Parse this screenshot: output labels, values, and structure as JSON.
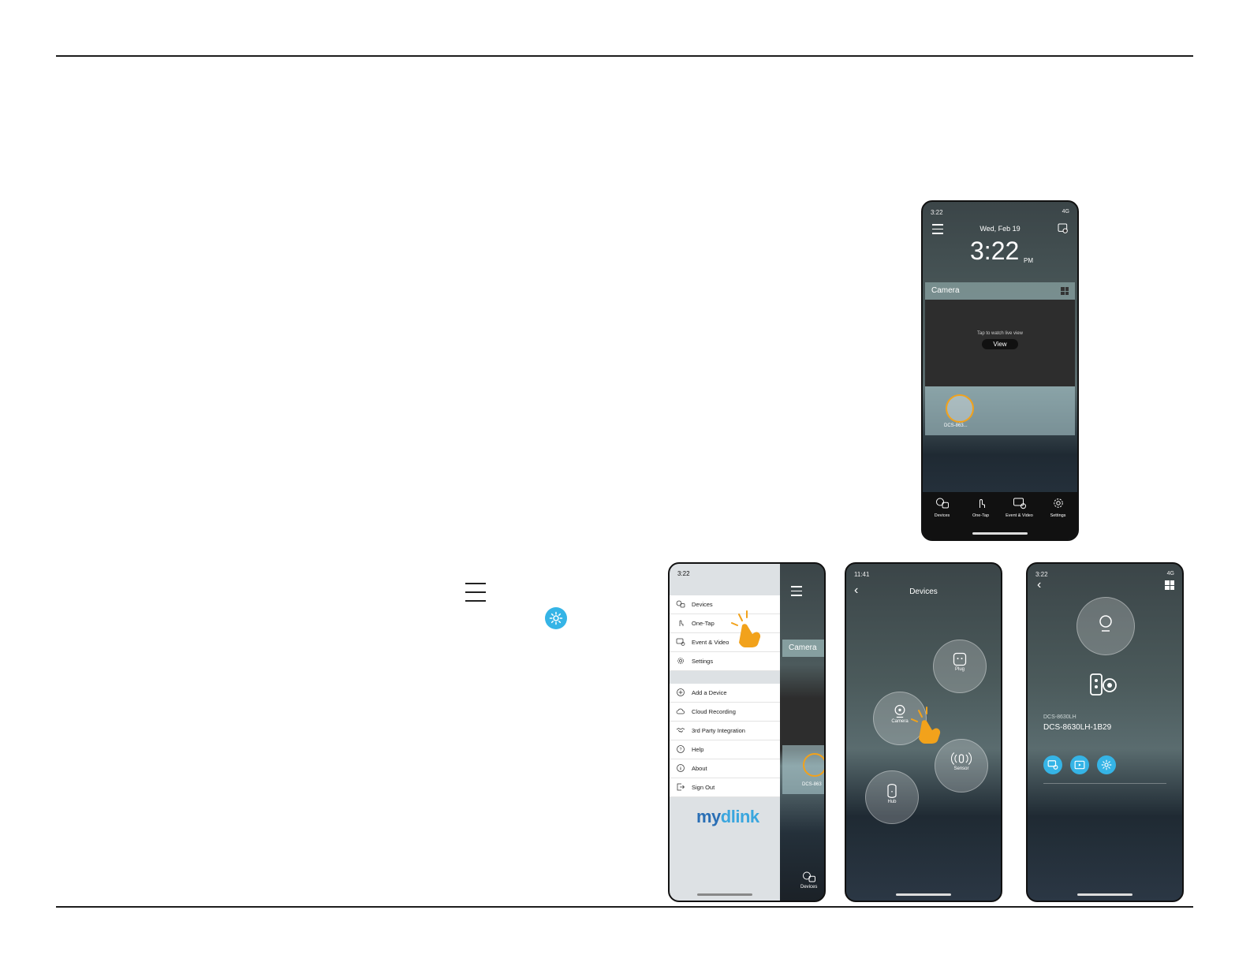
{
  "footer": {
    "text": ""
  },
  "phone_home": {
    "status_time": "3:22",
    "status_network": "4G",
    "date": "Wed, Feb 19",
    "time": "3:22",
    "ampm": "PM",
    "camera_header": "Camera",
    "tap_text": "Tap to watch live view",
    "view_button": "View",
    "device_label": "DCS-863...",
    "tabs": [
      {
        "label": "Devices",
        "icon": "devices-icon"
      },
      {
        "label": "One-Tap",
        "icon": "one-tap-icon"
      },
      {
        "label": "Event & Video",
        "icon": "event-video-icon"
      },
      {
        "label": "Settings",
        "icon": "settings-icon"
      }
    ]
  },
  "phone_menu": {
    "status_time": "3:22",
    "status_network": "4G",
    "main_items": [
      {
        "label": "Devices",
        "icon": "devices-icon"
      },
      {
        "label": "One-Tap",
        "icon": "one-tap-icon"
      },
      {
        "label": "Event & Video",
        "icon": "event-video-icon"
      },
      {
        "label": "Settings",
        "icon": "settings-icon"
      }
    ],
    "secondary_items": [
      {
        "label": "Add a Device",
        "icon": "add-icon"
      },
      {
        "label": "Cloud Recording",
        "icon": "cloud-icon"
      },
      {
        "label": "3rd Party Integration",
        "icon": "handshake-icon"
      },
      {
        "label": "Help",
        "icon": "help-icon"
      },
      {
        "label": "About",
        "icon": "info-icon"
      },
      {
        "label": "Sign Out",
        "icon": "sign-out-icon"
      }
    ],
    "logo_my": "my",
    "logo_dlink": "dlink",
    "background_camera": "Camera",
    "background_device": "DCS-863",
    "background_tab": "Devices"
  },
  "phone_devices": {
    "status_time": "11:41",
    "title": "Devices",
    "categories": [
      "Plug",
      "Camera",
      "Sensor",
      "Hub"
    ]
  },
  "phone_device_detail": {
    "status_time": "3:22",
    "status_network": "4G",
    "model": "DCS-8630LH",
    "device_name": "DCS-8630LH-1B29"
  },
  "colors": {
    "accent": "#35b4e6",
    "highlight": "#f2a21b"
  }
}
